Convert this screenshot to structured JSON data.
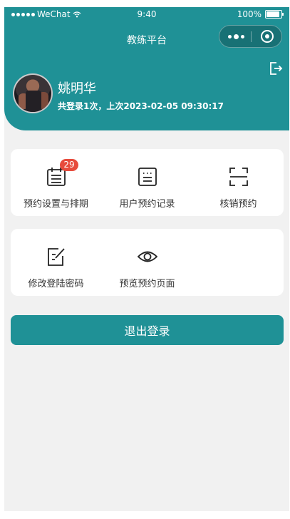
{
  "statusbar": {
    "carrier": "WeChat",
    "time": "9:40",
    "battery": "100%"
  },
  "nav": {
    "title": "教练平台"
  },
  "user": {
    "name": "姚明华",
    "meta": "共登录1次，上次2023-02-05 09:30:17"
  },
  "menu_row1": [
    {
      "label": "预约设置与排期",
      "icon": "calendar-icon",
      "badge": "29"
    },
    {
      "label": "用户预约记录",
      "icon": "record-list-icon"
    },
    {
      "label": "核销预约",
      "icon": "scan-icon"
    }
  ],
  "menu_row2": [
    {
      "label": "修改登陆密码",
      "icon": "edit-icon"
    },
    {
      "label": "预览预约页面",
      "icon": "eye-icon"
    }
  ],
  "logout_button": "退出登录",
  "colors": {
    "primary": "#1f9196",
    "background": "#f1f1f1",
    "badge": "#e74b3c"
  }
}
